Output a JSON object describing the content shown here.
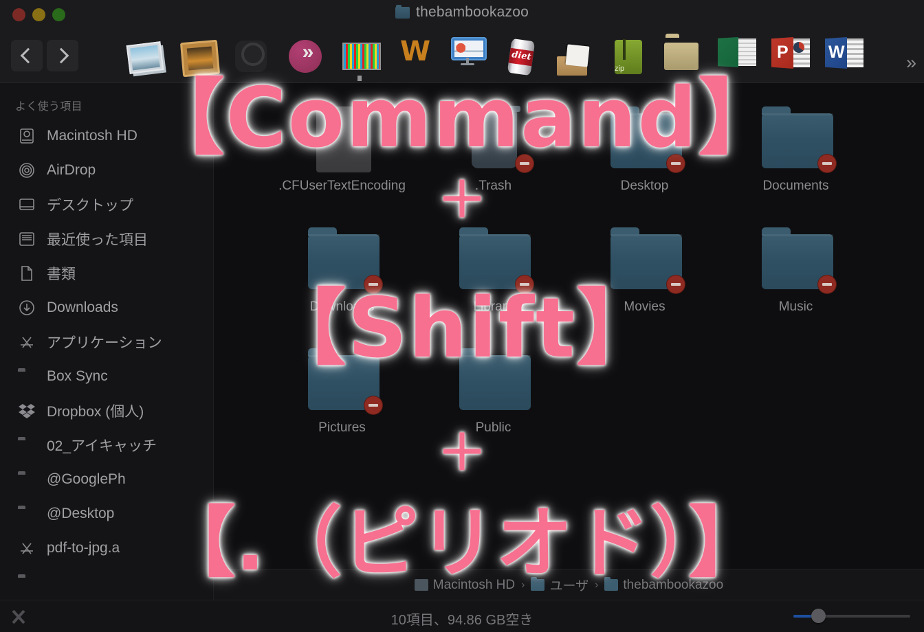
{
  "window": {
    "title": "thebambookazoo",
    "traffic_lights": [
      "close",
      "minimize",
      "zoom"
    ]
  },
  "toolbar": {
    "back_label": "‹",
    "forward_label": "›",
    "overflow_label": "»",
    "icons": [
      {
        "name": "photos-stack-icon"
      },
      {
        "name": "framed-photo-icon"
      },
      {
        "name": "ring-app-icon"
      },
      {
        "name": "sendy-app-icon"
      },
      {
        "name": "color-monitor-icon"
      },
      {
        "name": "wondershare-app-icon"
      },
      {
        "name": "keynote-app-icon"
      },
      {
        "name": "jpegmini-can-icon"
      },
      {
        "name": "unarchiver-icon"
      },
      {
        "name": "zip-utility-icon"
      },
      {
        "name": "tan-folder-icon"
      },
      {
        "name": "excel-document-icon"
      },
      {
        "name": "powerpoint-document-icon"
      },
      {
        "name": "word-document-icon"
      }
    ]
  },
  "sidebar": {
    "section_title": "よく使う項目",
    "items": [
      {
        "label": "Macintosh HD",
        "icon": "harddisk-icon"
      },
      {
        "label": "AirDrop",
        "icon": "airdrop-icon"
      },
      {
        "label": "デスクトップ",
        "icon": "desktop-icon"
      },
      {
        "label": "最近使った項目",
        "icon": "recents-icon"
      },
      {
        "label": "書類",
        "icon": "documents-icon"
      },
      {
        "label": "Downloads",
        "icon": "downloads-icon"
      },
      {
        "label": "アプリケーション",
        "icon": "applications-icon"
      },
      {
        "label": "Box Sync",
        "icon": "folder-icon"
      },
      {
        "label": "Dropbox (個人)",
        "icon": "dropbox-icon"
      },
      {
        "label": "02_アイキャッチ",
        "icon": "folder-icon"
      },
      {
        "label": "@GooglePh",
        "icon": "folder-icon"
      },
      {
        "label": "@Desktop",
        "icon": "folder-icon"
      },
      {
        "label": "pdf-to-jpg.a",
        "icon": "applications-icon"
      }
    ]
  },
  "files": [
    {
      "label": ".CFUserTextEncoding",
      "type": "document",
      "locked": false
    },
    {
      "label": ".Trash",
      "type": "trash",
      "locked": true
    },
    {
      "label": "Desktop",
      "type": "folder",
      "locked": true
    },
    {
      "label": "Documents",
      "type": "folder",
      "locked": true
    },
    {
      "label": "Downloads",
      "type": "folder",
      "locked": true
    },
    {
      "label": "Library",
      "type": "folder",
      "locked": true
    },
    {
      "label": "Movies",
      "type": "folder",
      "locked": true
    },
    {
      "label": "Music",
      "type": "folder",
      "locked": true
    },
    {
      "label": "Pictures",
      "type": "folder",
      "locked": true
    },
    {
      "label": "Public",
      "type": "folder",
      "locked": false
    }
  ],
  "pathbar": {
    "crumbs": [
      "Macintosh HD",
      "ユーザ",
      "thebambookazoo"
    ],
    "separator": "›"
  },
  "statusbar": {
    "text": "10項目、94.86 GB空き",
    "zoom_value": 22
  },
  "overlay": {
    "line1": "【Command】",
    "plus1": "＋",
    "line2": "【Shift】",
    "plus2": "＋",
    "line3": "【.（ピリオド）】",
    "color": "#f7708f"
  }
}
